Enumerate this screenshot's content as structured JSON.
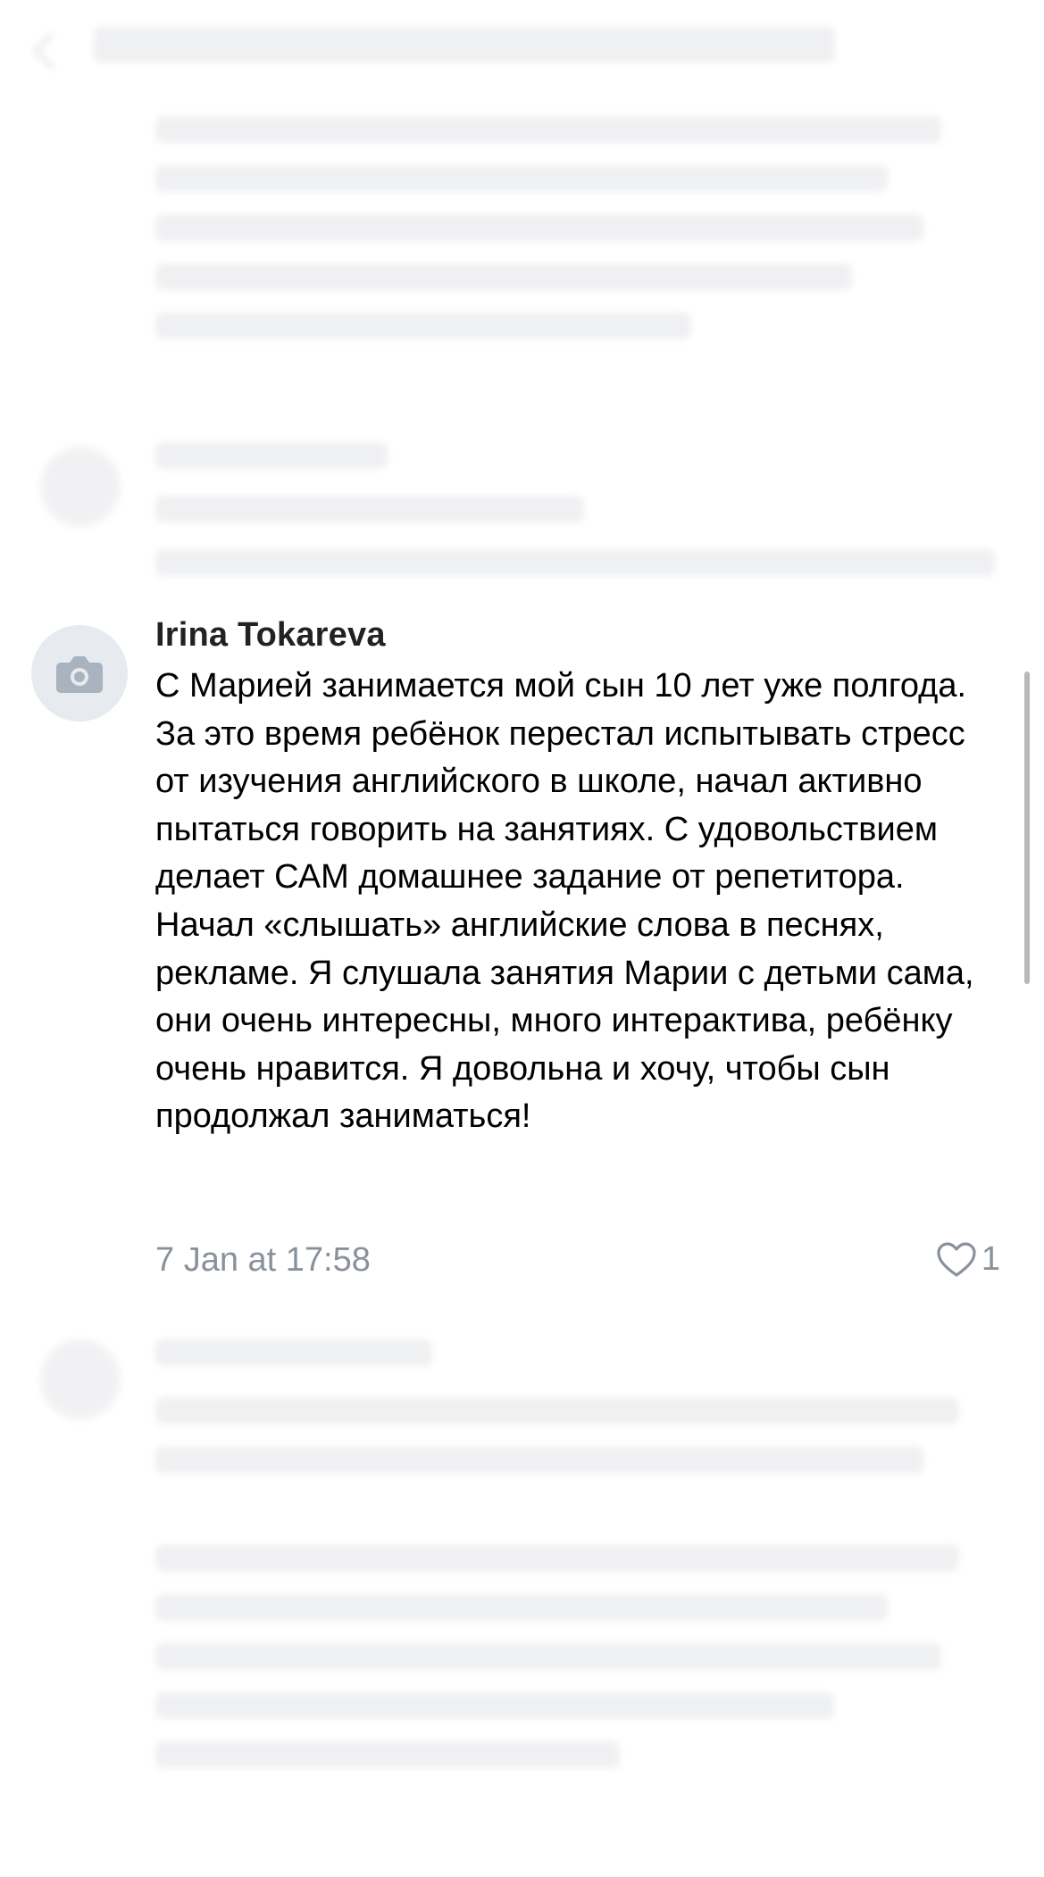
{
  "comment": {
    "author": "Irina Tokareva",
    "text": "С Марией занимается мой сын 10 лет уже полгода. За это время ребёнок перестал испытывать стресс от изучения английского в школе, начал активно пытаться говорить на занятиях. С удовольствием делает САМ домашнее задание от репетитора. Начал «слышать» английские слова в песнях, рекламе. Я слушала занятия Марии с детьми сама, они очень интересны, много интерактива, ребёнку очень нравится. Я довольна и хочу, чтобы сын продолжал заниматься!",
    "timestamp": "7 Jan at 17:58",
    "likes": "1",
    "avatar_icon": "camera-icon",
    "like_icon": "heart-outline-icon"
  },
  "colors": {
    "meta_gray": "#8a919c",
    "avatar_bg": "#e7ebf0",
    "avatar_icon": "#a9b3bf"
  }
}
